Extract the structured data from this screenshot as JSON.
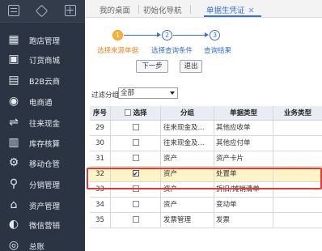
{
  "sidebar": {
    "items": [
      {
        "label": "跑店管理",
        "icon": "store-visit-icon",
        "glyph": "▦"
      },
      {
        "label": "订货商城",
        "icon": "mall-icon",
        "glyph": "▣"
      },
      {
        "label": "B2B云商",
        "icon": "b2b-icon",
        "glyph": "▤"
      },
      {
        "label": "电商通",
        "icon": "ecommerce-icon",
        "glyph": "◉"
      },
      {
        "label": "往来现金",
        "icon": "cash-icon",
        "glyph": "⇌"
      },
      {
        "label": "库存核算",
        "icon": "inventory-icon",
        "glyph": "▥"
      },
      {
        "label": "移动仓管",
        "icon": "mobile-warehouse-icon",
        "glyph": "⚙"
      },
      {
        "label": "分销管理",
        "icon": "distribution-icon",
        "glyph": "⚲"
      },
      {
        "label": "资产管理",
        "icon": "asset-icon",
        "glyph": "⌂"
      },
      {
        "label": "微信营销",
        "icon": "wechat-icon",
        "glyph": "◐"
      },
      {
        "label": "总账",
        "icon": "ledger-icon",
        "glyph": "◎"
      }
    ]
  },
  "tabs": {
    "t1": "我的桌面",
    "t2": "初始化导航",
    "t3": "单据生凭证",
    "close": "✕"
  },
  "steps": {
    "s1_num": "1",
    "s1_label": "选择来源单据",
    "s2_num": "2",
    "s2_label": "选择查询条件",
    "s3_num": "3",
    "s3_label": "查询结果"
  },
  "buttons": {
    "next": "下一步",
    "exit": "退出"
  },
  "filter": {
    "label": "过滤分组:",
    "value": "全部"
  },
  "table": {
    "headers": {
      "num": "序号",
      "select": "选择",
      "group": "分组",
      "type": "单据类型",
      "biz": "业务类型"
    },
    "rows": [
      {
        "num": "29",
        "group": "往来现金及...",
        "type": "其他应收单",
        "biz": "",
        "checked": false
      },
      {
        "num": "30",
        "group": "往来现金及...",
        "type": "其他应付单",
        "biz": "",
        "checked": false
      },
      {
        "num": "31",
        "group": "资产",
        "type": "资产卡片",
        "biz": "",
        "checked": false
      },
      {
        "num": "32",
        "group": "资产",
        "type": "处置单",
        "biz": "",
        "checked": true
      },
      {
        "num": "33",
        "group": "资产",
        "type": "折旧/摊销清单",
        "biz": "",
        "checked": false
      },
      {
        "num": "34",
        "group": "资产",
        "type": "变动单",
        "biz": "",
        "checked": false
      },
      {
        "num": "35",
        "group": "发票管理",
        "type": "发票",
        "biz": "",
        "checked": false
      }
    ]
  },
  "colors": {
    "sidebar_bg": "#2b3442",
    "accent": "#3a6fd0",
    "step_current": "#f7b13a",
    "highlight_row": "#fff3c8",
    "highlight_frame": "#e53935"
  }
}
